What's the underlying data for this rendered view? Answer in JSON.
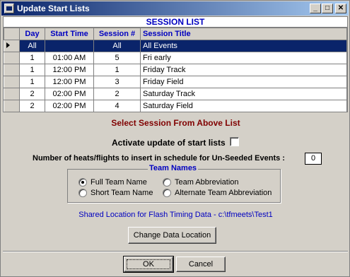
{
  "window": {
    "title": "Update Start Lists",
    "min_glyph": "_",
    "max_glyph": "□",
    "close_glyph": "✕"
  },
  "grid": {
    "caption": "SESSION LIST",
    "columns": [
      "Day",
      "Start Time",
      "Session #",
      "Session Title"
    ],
    "rows": [
      {
        "day": "All",
        "start": "",
        "session": "All",
        "title": "All Events",
        "active": true
      },
      {
        "day": "1",
        "start": "01:00 AM",
        "session": "5",
        "title": "Fri early"
      },
      {
        "day": "1",
        "start": "12:00 PM",
        "session": "1",
        "title": "Friday Track"
      },
      {
        "day": "1",
        "start": "12:00 PM",
        "session": "3",
        "title": "Friday Field"
      },
      {
        "day": "2",
        "start": "02:00 PM",
        "session": "2",
        "title": "Saturday Track"
      },
      {
        "day": "2",
        "start": "02:00 PM",
        "session": "4",
        "title": "Saturday Field"
      }
    ]
  },
  "select_message": "Select Session From Above List",
  "activate_label": "Activate update of start lists",
  "heats_label": "Number of heats/flights to insert in schedule for Un-Seeded Events :",
  "heats_value": "0",
  "team_names": {
    "legend": "Team Names",
    "opt1": "Full Team Name",
    "opt2": "Team Abbreviation",
    "opt3": "Short Team Name",
    "opt4": "Alternate Team Abbreviation"
  },
  "shared_location": "Shared Location for Flash Timing Data  -  c:\\tfmeets\\Test1",
  "buttons": {
    "change": "Change Data Location",
    "ok": "OK",
    "cancel": "Cancel"
  }
}
